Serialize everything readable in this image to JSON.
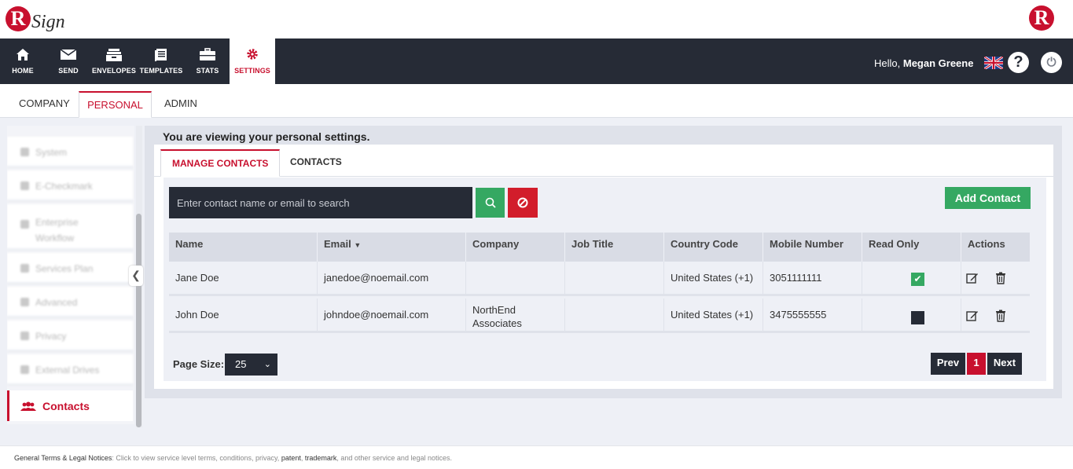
{
  "brand": {
    "logo_letter": "R",
    "logo_word": "Sign"
  },
  "nav": {
    "items": [
      {
        "label": "HOME",
        "icon": "home-icon"
      },
      {
        "label": "SEND",
        "icon": "envelope-icon"
      },
      {
        "label": "ENVELOPES",
        "icon": "inbox-icon"
      },
      {
        "label": "TEMPLATES",
        "icon": "templates-icon"
      },
      {
        "label": "STATS",
        "icon": "briefcase-icon"
      },
      {
        "label": "SETTINGS",
        "icon": "gear-icon",
        "active": true
      }
    ],
    "hello": "Hello,",
    "user": "Megan Greene",
    "help": "?",
    "power": "⏻"
  },
  "settings_tabs": [
    "COMPANY",
    "PERSONAL",
    "ADMIN"
  ],
  "sidebar": {
    "items": [
      "System",
      "E-Checkmark",
      "Enterprise Workflow",
      "Services Plan",
      "Advanced",
      "Privacy",
      "External Drives"
    ],
    "active": "Contacts"
  },
  "main": {
    "title": "You are viewing your personal settings.",
    "tabs": [
      "MANAGE CONTACTS",
      "CONTACTS"
    ]
  },
  "search": {
    "placeholder": "Enter contact name or email to search"
  },
  "add_contact": "Add Contact",
  "table": {
    "columns": [
      "Name",
      "Email",
      "Company",
      "Job Title",
      "Country Code",
      "Mobile Number",
      "Read Only",
      "Actions"
    ],
    "rows": [
      {
        "name": "Jane Doe",
        "email": "janedoe@noemail.com",
        "company": "",
        "job_title": "",
        "country_code": "United States (+1)",
        "mobile": "3051111111",
        "read_only": true
      },
      {
        "name": "John Doe",
        "email": "johndoe@noemail.com",
        "company": "NorthEnd Associates",
        "company_l1": "NorthEnd",
        "company_l2": "Associates",
        "job_title": "",
        "country_code": "United States (+1)",
        "mobile": "3475555555",
        "read_only": false
      }
    ]
  },
  "pagination": {
    "page_size_label": "Page Size:",
    "page_size": "25",
    "prev": "Prev",
    "current": "1",
    "next": "Next"
  },
  "footer": {
    "title": "General Terms & Legal Notices",
    "text1": ": Click to view service level terms, conditions, privacy,",
    "patent": "patent",
    "trademark": "trademark",
    "text2": ", and other service and legal notices."
  },
  "colors": {
    "accent": "#c8102e",
    "nav_bg": "#262b36",
    "success": "#35a862"
  }
}
